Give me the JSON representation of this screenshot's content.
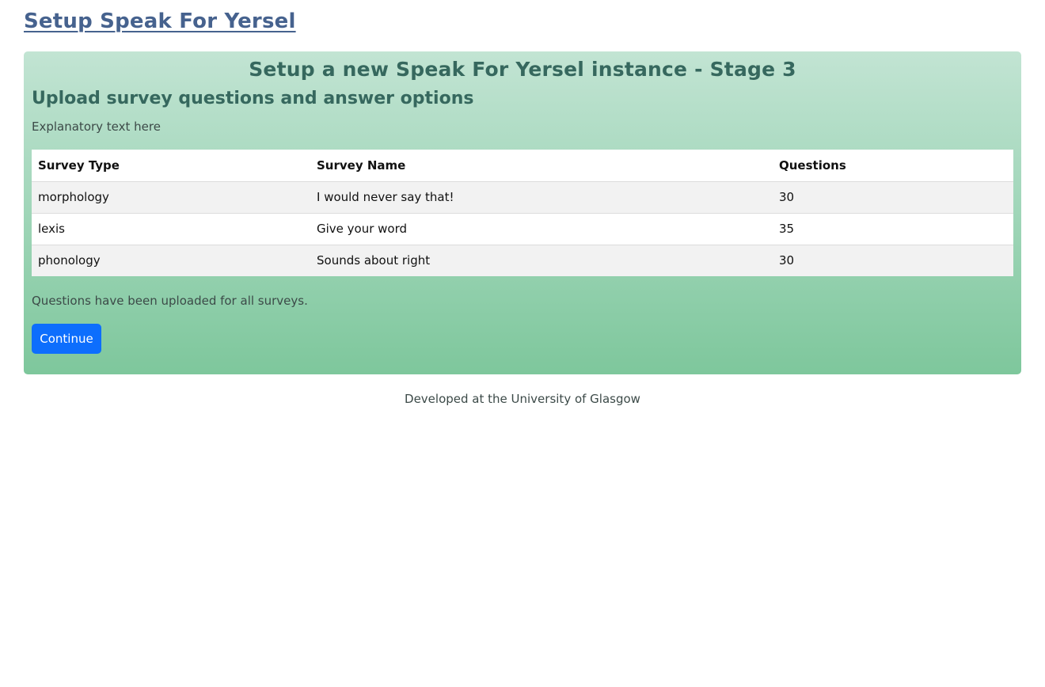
{
  "header": {
    "title": "Setup Speak For Yersel"
  },
  "panel": {
    "stage_title": "Setup a new Speak For Yersel instance - Stage 3",
    "section_heading": "Upload survey questions and answer options",
    "explanatory_text": "Explanatory text here",
    "table": {
      "columns": [
        "Survey Type",
        "Survey Name",
        "Questions"
      ],
      "rows": [
        {
          "type": "morphology",
          "name": "I would never say that!",
          "questions": "30"
        },
        {
          "type": "lexis",
          "name": "Give your word",
          "questions": "35"
        },
        {
          "type": "phonology",
          "name": "Sounds about right",
          "questions": "30"
        }
      ]
    },
    "status_text": "Questions have been uploaded for all surveys.",
    "continue_label": "Continue"
  },
  "footer": {
    "text": "Developed at the University of Glasgow"
  },
  "colors": {
    "title_link": "#46628e",
    "heading": "#36685e",
    "panel_gradient_top": "#c2e4d3",
    "panel_gradient_bottom": "#7ec79c",
    "primary_button": "#0d6efd"
  }
}
